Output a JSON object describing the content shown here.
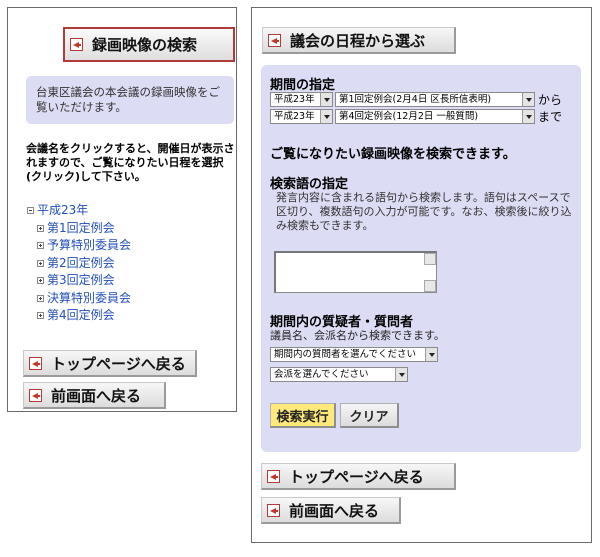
{
  "left": {
    "search_video_label": "録画映像の検索",
    "description": "台東区議会の本会議の録画映像をご覧いただけます。",
    "instruction": "会議名をクリックすると、開催日が表示されますので、ご覧になりたい日程を選択(クリック)して下さい。",
    "tree": {
      "root": "平成23年",
      "children": [
        "第1回定例会",
        "予算特別委員会",
        "第2回定例会",
        "第3回定例会",
        "決算特別委員会",
        "第4回定例会"
      ]
    },
    "top_page_label": "トップページへ戻る",
    "prev_page_label": "前画面へ戻る"
  },
  "right": {
    "schedule_label": "議会の日程から選ぶ",
    "period": {
      "title": "期間の指定",
      "from_year": "平成23年",
      "from_session": "第1回定例会(2月4日 区長所信表明)",
      "from_suffix": "から",
      "to_year": "平成23年",
      "to_session": "第4回定例会(12月2日 一般質問)",
      "to_suffix": "まで",
      "note": "ご覧になりたい録画映像を検索できます。"
    },
    "keyword": {
      "title": "検索語の指定",
      "description": "発言内容に含まれる語句から検索します。語句はスペースで区切り、複数語句の入力が可能です。なお、検索後に絞り込み検索もできます。",
      "value": ""
    },
    "questioner": {
      "title": "期間内の質疑者・質問者",
      "description": "議員名、会派名から検索できます。",
      "member_select": "期間内の質問者を選んでください",
      "party_select": "会派を選んでください"
    },
    "execute_label": "検索実行",
    "clear_label": "クリア",
    "top_page_label": "トップページへ戻る",
    "prev_page_label": "前画面へ戻る"
  },
  "colors": {
    "box_bg": "#dcdcf4",
    "link": "#2250b8",
    "execute_bg": "#ffe97a",
    "highlight_border": "#b03a3a"
  }
}
